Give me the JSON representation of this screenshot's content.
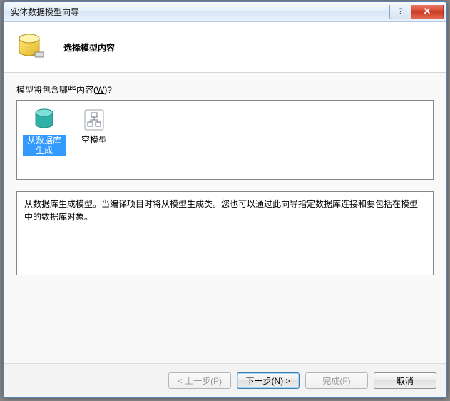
{
  "window": {
    "title": "实体数据模型向导",
    "help_glyph": "?",
    "close_glyph": "✕"
  },
  "header": {
    "heading": "选择模型内容"
  },
  "body": {
    "prompt_prefix": "模型将包含哪些内容(",
    "prompt_ak": "W",
    "prompt_suffix": ")?",
    "options": [
      {
        "label": "从数据库生成",
        "icon": "db-generate",
        "selected": true
      },
      {
        "label": "空模型",
        "icon": "empty-model",
        "selected": false
      }
    ],
    "description": "从数据库生成模型。当编译项目时将从模型生成类。您也可以通过此向导指定数据库连接和要包括在模型中的数据库对象。"
  },
  "footer": {
    "back": {
      "prefix": "< 上一步(",
      "ak": "P",
      "suffix": ")"
    },
    "next": {
      "prefix": "下一步(",
      "ak": "N",
      "suffix": ") >"
    },
    "finish": {
      "prefix": "完成(",
      "ak": "F",
      "suffix": ")"
    },
    "cancel": {
      "label": "取消"
    }
  }
}
